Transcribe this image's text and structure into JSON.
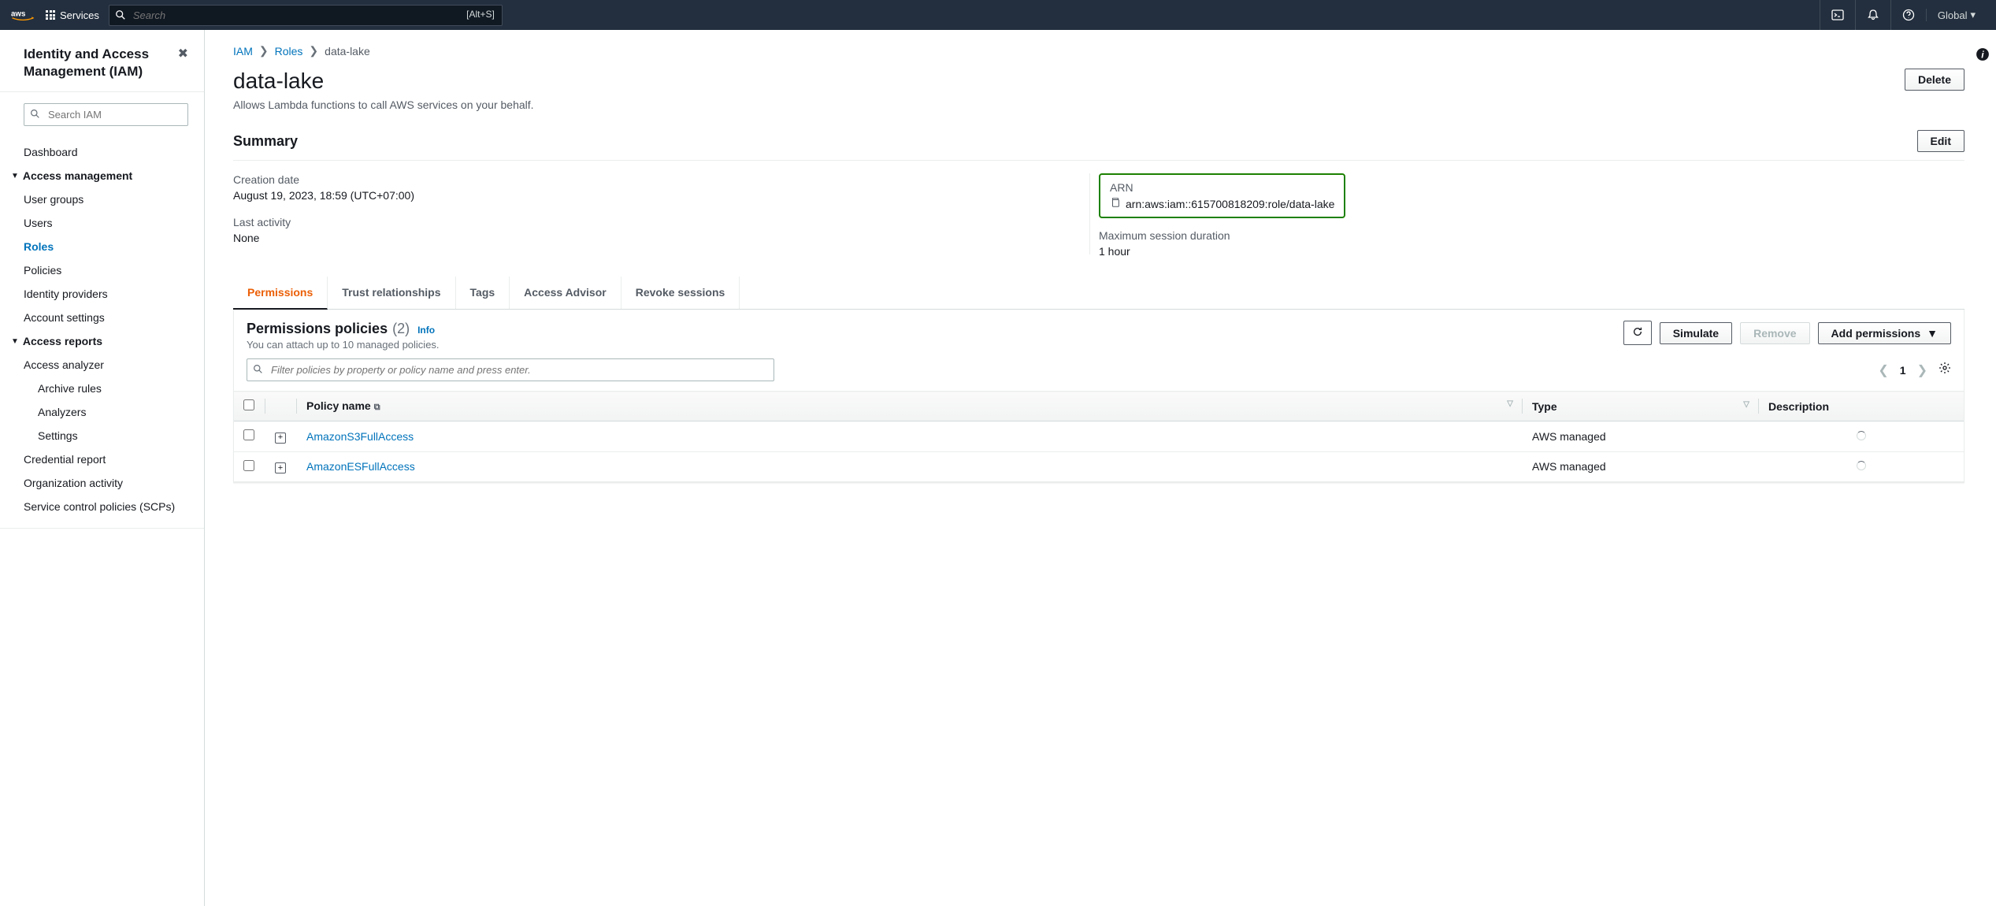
{
  "topnav": {
    "services": "Services",
    "search_placeholder": "Search",
    "search_hint": "[Alt+S]",
    "region": "Global"
  },
  "sidebar": {
    "title": "Identity and Access Management (IAM)",
    "search_placeholder": "Search IAM",
    "items": {
      "dashboard": "Dashboard",
      "access_mgmt": "Access management",
      "user_groups": "User groups",
      "users": "Users",
      "roles": "Roles",
      "policies": "Policies",
      "identity_providers": "Identity providers",
      "account_settings": "Account settings",
      "access_reports": "Access reports",
      "access_analyzer": "Access analyzer",
      "archive_rules": "Archive rules",
      "analyzers": "Analyzers",
      "settings": "Settings",
      "credential_report": "Credential report",
      "org_activity": "Organization activity",
      "scps": "Service control policies (SCPs)"
    }
  },
  "breadcrumb": {
    "iam": "IAM",
    "roles": "Roles",
    "current": "data-lake"
  },
  "page": {
    "title": "data-lake",
    "desc": "Allows Lambda functions to call AWS services on your behalf.",
    "delete": "Delete",
    "summary": "Summary",
    "edit": "Edit"
  },
  "summary": {
    "creation_label": "Creation date",
    "creation_val": "August 19, 2023, 18:59 (UTC+07:00)",
    "arn_label": "ARN",
    "arn_val": "arn:aws:iam::615700818209:role/data-lake",
    "last_activity_label": "Last activity",
    "last_activity_val": "None",
    "max_session_label": "Maximum session duration",
    "max_session_val": "1 hour"
  },
  "tabs": {
    "permissions": "Permissions",
    "trust": "Trust relationships",
    "tags": "Tags",
    "advisor": "Access Advisor",
    "revoke": "Revoke sessions"
  },
  "panel": {
    "title": "Permissions policies",
    "count": "(2)",
    "info": "Info",
    "sub": "You can attach up to 10 managed policies.",
    "refresh": "Refresh",
    "simulate": "Simulate",
    "remove": "Remove",
    "add": "Add permissions",
    "filter_placeholder": "Filter policies by property or policy name and press enter.",
    "page": "1"
  },
  "table": {
    "col_policy": "Policy name",
    "col_type": "Type",
    "col_desc": "Description",
    "rows": [
      {
        "name": "AmazonS3FullAccess",
        "type": "AWS managed"
      },
      {
        "name": "AmazonESFullAccess",
        "type": "AWS managed"
      }
    ]
  }
}
